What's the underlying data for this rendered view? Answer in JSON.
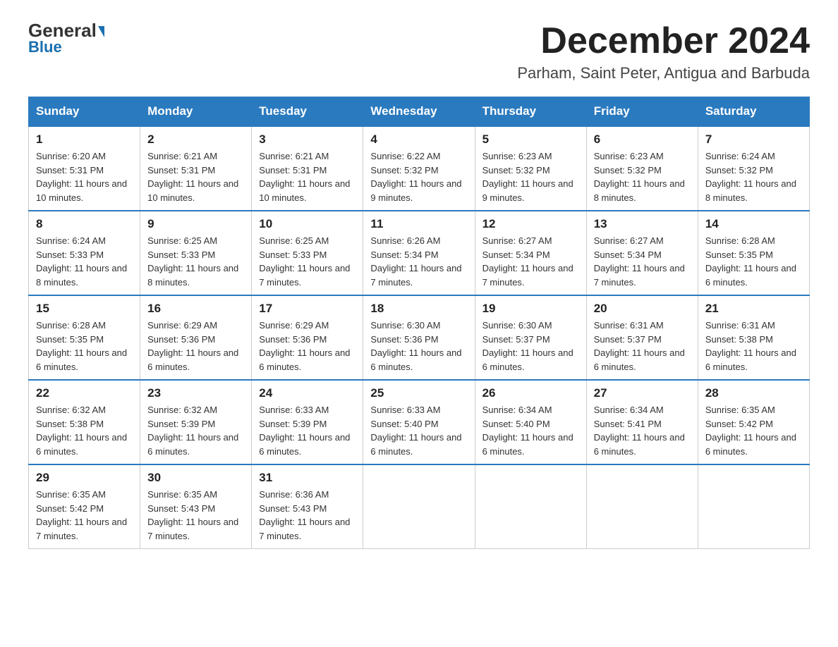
{
  "header": {
    "logo_general": "General",
    "logo_blue": "Blue",
    "month_title": "December 2024",
    "location": "Parham, Saint Peter, Antigua and Barbuda"
  },
  "days_of_week": [
    "Sunday",
    "Monday",
    "Tuesday",
    "Wednesday",
    "Thursday",
    "Friday",
    "Saturday"
  ],
  "weeks": [
    [
      {
        "day": "1",
        "sunrise": "6:20 AM",
        "sunset": "5:31 PM",
        "daylight": "11 hours and 10 minutes."
      },
      {
        "day": "2",
        "sunrise": "6:21 AM",
        "sunset": "5:31 PM",
        "daylight": "11 hours and 10 minutes."
      },
      {
        "day": "3",
        "sunrise": "6:21 AM",
        "sunset": "5:31 PM",
        "daylight": "11 hours and 10 minutes."
      },
      {
        "day": "4",
        "sunrise": "6:22 AM",
        "sunset": "5:32 PM",
        "daylight": "11 hours and 9 minutes."
      },
      {
        "day": "5",
        "sunrise": "6:23 AM",
        "sunset": "5:32 PM",
        "daylight": "11 hours and 9 minutes."
      },
      {
        "day": "6",
        "sunrise": "6:23 AM",
        "sunset": "5:32 PM",
        "daylight": "11 hours and 8 minutes."
      },
      {
        "day": "7",
        "sunrise": "6:24 AM",
        "sunset": "5:32 PM",
        "daylight": "11 hours and 8 minutes."
      }
    ],
    [
      {
        "day": "8",
        "sunrise": "6:24 AM",
        "sunset": "5:33 PM",
        "daylight": "11 hours and 8 minutes."
      },
      {
        "day": "9",
        "sunrise": "6:25 AM",
        "sunset": "5:33 PM",
        "daylight": "11 hours and 8 minutes."
      },
      {
        "day": "10",
        "sunrise": "6:25 AM",
        "sunset": "5:33 PM",
        "daylight": "11 hours and 7 minutes."
      },
      {
        "day": "11",
        "sunrise": "6:26 AM",
        "sunset": "5:34 PM",
        "daylight": "11 hours and 7 minutes."
      },
      {
        "day": "12",
        "sunrise": "6:27 AM",
        "sunset": "5:34 PM",
        "daylight": "11 hours and 7 minutes."
      },
      {
        "day": "13",
        "sunrise": "6:27 AM",
        "sunset": "5:34 PM",
        "daylight": "11 hours and 7 minutes."
      },
      {
        "day": "14",
        "sunrise": "6:28 AM",
        "sunset": "5:35 PM",
        "daylight": "11 hours and 6 minutes."
      }
    ],
    [
      {
        "day": "15",
        "sunrise": "6:28 AM",
        "sunset": "5:35 PM",
        "daylight": "11 hours and 6 minutes."
      },
      {
        "day": "16",
        "sunrise": "6:29 AM",
        "sunset": "5:36 PM",
        "daylight": "11 hours and 6 minutes."
      },
      {
        "day": "17",
        "sunrise": "6:29 AM",
        "sunset": "5:36 PM",
        "daylight": "11 hours and 6 minutes."
      },
      {
        "day": "18",
        "sunrise": "6:30 AM",
        "sunset": "5:36 PM",
        "daylight": "11 hours and 6 minutes."
      },
      {
        "day": "19",
        "sunrise": "6:30 AM",
        "sunset": "5:37 PM",
        "daylight": "11 hours and 6 minutes."
      },
      {
        "day": "20",
        "sunrise": "6:31 AM",
        "sunset": "5:37 PM",
        "daylight": "11 hours and 6 minutes."
      },
      {
        "day": "21",
        "sunrise": "6:31 AM",
        "sunset": "5:38 PM",
        "daylight": "11 hours and 6 minutes."
      }
    ],
    [
      {
        "day": "22",
        "sunrise": "6:32 AM",
        "sunset": "5:38 PM",
        "daylight": "11 hours and 6 minutes."
      },
      {
        "day": "23",
        "sunrise": "6:32 AM",
        "sunset": "5:39 PM",
        "daylight": "11 hours and 6 minutes."
      },
      {
        "day": "24",
        "sunrise": "6:33 AM",
        "sunset": "5:39 PM",
        "daylight": "11 hours and 6 minutes."
      },
      {
        "day": "25",
        "sunrise": "6:33 AM",
        "sunset": "5:40 PM",
        "daylight": "11 hours and 6 minutes."
      },
      {
        "day": "26",
        "sunrise": "6:34 AM",
        "sunset": "5:40 PM",
        "daylight": "11 hours and 6 minutes."
      },
      {
        "day": "27",
        "sunrise": "6:34 AM",
        "sunset": "5:41 PM",
        "daylight": "11 hours and 6 minutes."
      },
      {
        "day": "28",
        "sunrise": "6:35 AM",
        "sunset": "5:42 PM",
        "daylight": "11 hours and 6 minutes."
      }
    ],
    [
      {
        "day": "29",
        "sunrise": "6:35 AM",
        "sunset": "5:42 PM",
        "daylight": "11 hours and 7 minutes."
      },
      {
        "day": "30",
        "sunrise": "6:35 AM",
        "sunset": "5:43 PM",
        "daylight": "11 hours and 7 minutes."
      },
      {
        "day": "31",
        "sunrise": "6:36 AM",
        "sunset": "5:43 PM",
        "daylight": "11 hours and 7 minutes."
      },
      null,
      null,
      null,
      null
    ]
  ],
  "labels": {
    "sunrise_prefix": "Sunrise: ",
    "sunset_prefix": "Sunset: ",
    "daylight_prefix": "Daylight: "
  }
}
